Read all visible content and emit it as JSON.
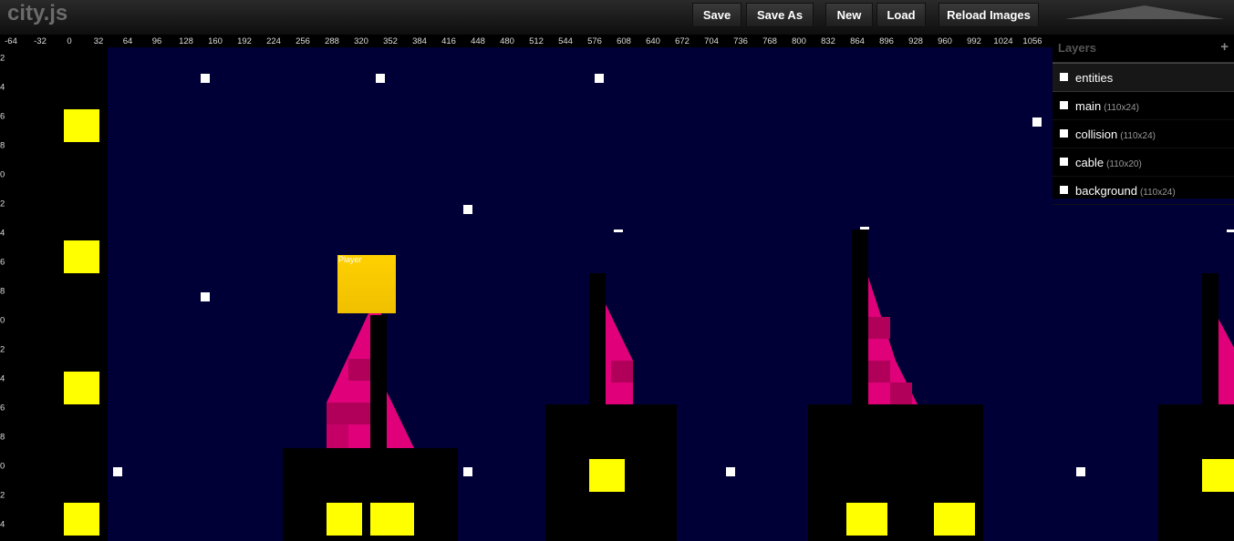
{
  "app": {
    "title": "city.js"
  },
  "toolbar": {
    "save": "Save",
    "save_as": "Save As",
    "new": "New",
    "load": "Load",
    "reload_images": "Reload Images"
  },
  "ruler_x": [
    "-64",
    "-32",
    "0",
    "32",
    "64",
    "96",
    "128",
    "160",
    "192",
    "224",
    "256",
    "288",
    "320",
    "352",
    "384",
    "416",
    "448",
    "480",
    "512",
    "544",
    "576",
    "608",
    "640",
    "672",
    "704",
    "736",
    "768",
    "800",
    "832",
    "864",
    "896",
    "928",
    "960",
    "992",
    "1024",
    "1056"
  ],
  "ruler_y": [
    "2",
    "4",
    "6",
    "8",
    "0",
    "2",
    "4",
    "6",
    "8",
    "0",
    "2",
    "4",
    "6",
    "8",
    "0",
    "2",
    "4"
  ],
  "player_label": "Player",
  "layers_panel": {
    "title": "Layers",
    "add": "+",
    "items": [
      {
        "name": "entities",
        "size": ""
      },
      {
        "name": "main",
        "size": "(110x24)"
      },
      {
        "name": "collision",
        "size": "(110x24)"
      },
      {
        "name": "cable",
        "size": "(110x20)"
      },
      {
        "name": "background",
        "size": "(110x24)"
      }
    ]
  },
  "colors": {
    "sky": "#000037",
    "window": "#ffff00",
    "player": "#f5c800",
    "flame": "#e0007a"
  }
}
